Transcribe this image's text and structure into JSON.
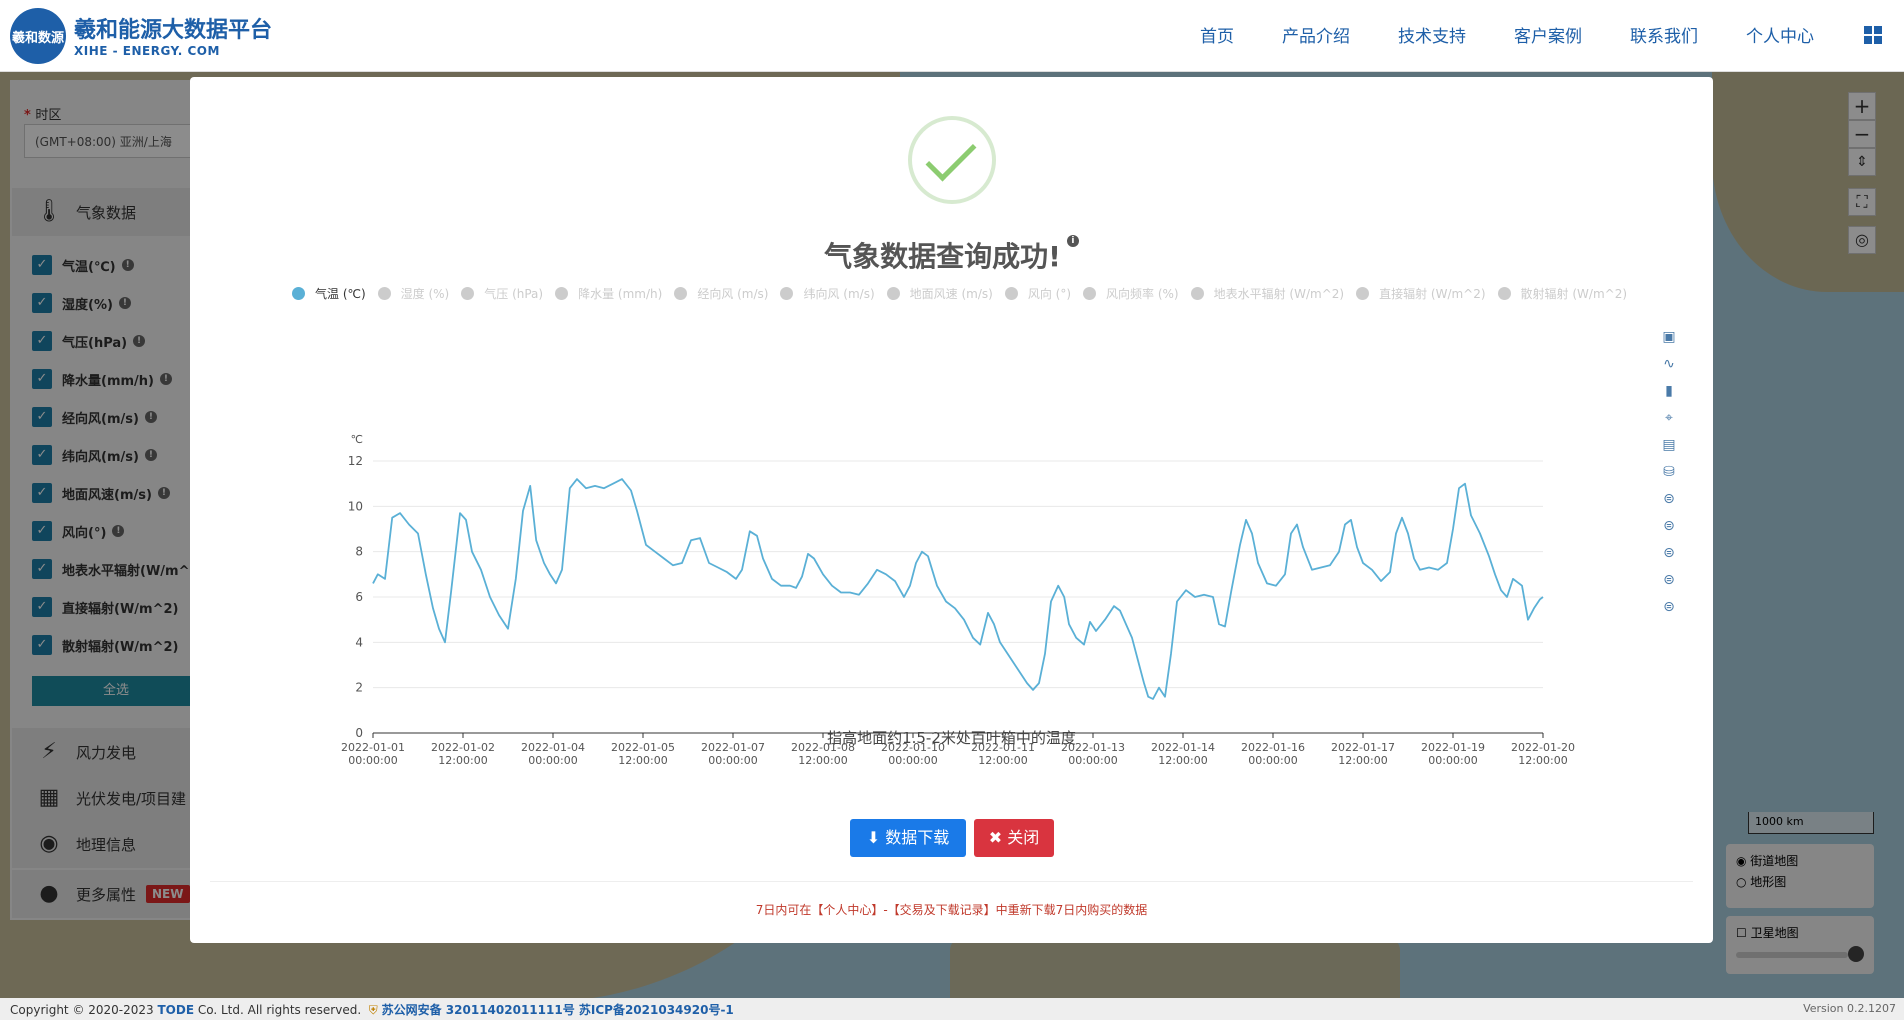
{
  "header": {
    "logo_text": "羲和数源",
    "title": "羲和能源大数据平台",
    "subtitle": "XIHE - ENERGY. COM",
    "nav": [
      "首页",
      "产品介绍",
      "技术支持",
      "客户案例",
      "联系我们",
      "个人中心"
    ]
  },
  "sidebar": {
    "timezone_label": "时区",
    "timezone_value": "(GMT+08:00) 亚洲/上海",
    "meteo_label": "气象数据",
    "items": [
      {
        "label": "气温(℃)"
      },
      {
        "label": "湿度(%)"
      },
      {
        "label": "气压(hPa)"
      },
      {
        "label": "降水量(mm/h)"
      },
      {
        "label": "经向风(m/s)"
      },
      {
        "label": "纬向风(m/s)"
      },
      {
        "label": "地面风速(m/s)"
      },
      {
        "label": "风向(°)"
      },
      {
        "label": "地表水平辐射(W/m^"
      },
      {
        "label": "直接辐射(W/m^2)"
      },
      {
        "label": "散射辐射(W/m^2)"
      }
    ],
    "select_all": "全选",
    "wind": "风力发电",
    "pv": "光伏发电/项目建",
    "geo": "地理信息",
    "more": "更多属性",
    "new_badge": "NEW"
  },
  "map": {
    "scale": "1000 km",
    "layer_street": "街道地图",
    "layer_terrain": "地形图",
    "satellite": "卫星地图",
    "satellite_opacity": 0.95
  },
  "footer": {
    "copyright": "Copyright © 2020-2023 ",
    "company": "TODE",
    "rights": " Co. Ltd. All rights reserved.",
    "beian": "苏公网安备 32011402011111号 苏ICP备2021034920号-1",
    "version": "Version 0.2.1207"
  },
  "modal": {
    "title": "气象数据查询成功!",
    "legend": [
      {
        "label": "气温 (℃)",
        "active": true
      },
      {
        "label": "湿度 (%)",
        "active": false
      },
      {
        "label": "气压 (hPa)",
        "active": false
      },
      {
        "label": "降水量 (mm/h)",
        "active": false
      },
      {
        "label": "经向风 (m/s)",
        "active": false
      },
      {
        "label": "纬向风 (m/s)",
        "active": false
      },
      {
        "label": "地面风速 (m/s)",
        "active": false
      },
      {
        "label": "风向 (°)",
        "active": false
      },
      {
        "label": "风向频率 (%)",
        "active": false
      },
      {
        "label": "地表水平辐射 (W/m^2)",
        "active": false
      },
      {
        "label": "直接辐射 (W/m^2)",
        "active": false
      },
      {
        "label": "散射辐射 (W/m^2)",
        "active": false
      }
    ],
    "description": "指高地面约1.5-2米处百叶箱中的温度",
    "download_label": "数据下载",
    "close_label": "关闭",
    "note": "7日内可在【个人中心】-【交易及下载记录】中重新下载7日内购买的数据"
  },
  "chart_data": {
    "type": "line",
    "series": [
      {
        "name": "气温 (℃)",
        "color": "#5ab0d6"
      }
    ],
    "ylabel": "℃",
    "ylim": [
      0,
      12
    ],
    "yticks": [
      0,
      2,
      4,
      6,
      8,
      10,
      12
    ],
    "xlim": [
      0,
      19.5
    ],
    "xticks": [
      {
        "x": 0,
        "date": "2022-01-01",
        "time": "00:00:00"
      },
      {
        "x": 1.5,
        "date": "2022-01-02",
        "time": "12:00:00"
      },
      {
        "x": 3,
        "date": "2022-01-04",
        "time": "00:00:00"
      },
      {
        "x": 4.5,
        "date": "2022-01-05",
        "time": "12:00:00"
      },
      {
        "x": 6,
        "date": "2022-01-07",
        "time": "00:00:00"
      },
      {
        "x": 7.5,
        "date": "2022-01-08",
        "time": "12:00:00"
      },
      {
        "x": 9,
        "date": "2022-01-10",
        "time": "00:00:00"
      },
      {
        "x": 10.5,
        "date": "2022-01-11",
        "time": "12:00:00"
      },
      {
        "x": 12,
        "date": "2022-01-13",
        "time": "00:00:00"
      },
      {
        "x": 13.5,
        "date": "2022-01-14",
        "time": "12:00:00"
      },
      {
        "x": 15,
        "date": "2022-01-16",
        "time": "00:00:00"
      },
      {
        "x": 16.5,
        "date": "2022-01-17",
        "time": "12:00:00"
      },
      {
        "x": 18,
        "date": "2022-01-19",
        "time": "00:00:00"
      },
      {
        "x": 19.5,
        "date": "2022-01-20",
        "time": "12:00:00"
      }
    ],
    "points": [
      [
        0,
        6.6
      ],
      [
        0.08,
        7.0
      ],
      [
        0.2,
        6.8
      ],
      [
        0.32,
        9.5
      ],
      [
        0.45,
        9.7
      ],
      [
        0.6,
        9.2
      ],
      [
        0.75,
        8.8
      ],
      [
        0.88,
        7.0
      ],
      [
        1.0,
        5.5
      ],
      [
        1.1,
        4.6
      ],
      [
        1.2,
        4.0
      ],
      [
        1.3,
        6.2
      ],
      [
        1.45,
        9.7
      ],
      [
        1.55,
        9.4
      ],
      [
        1.65,
        8.0
      ],
      [
        1.8,
        7.2
      ],
      [
        1.95,
        6.0
      ],
      [
        2.1,
        5.2
      ],
      [
        2.25,
        4.6
      ],
      [
        2.38,
        6.8
      ],
      [
        2.5,
        9.8
      ],
      [
        2.62,
        10.9
      ],
      [
        2.72,
        8.5
      ],
      [
        2.85,
        7.5
      ],
      [
        2.95,
        7.0
      ],
      [
        3.05,
        6.6
      ],
      [
        3.15,
        7.2
      ],
      [
        3.28,
        10.8
      ],
      [
        3.4,
        11.2
      ],
      [
        3.55,
        10.8
      ],
      [
        3.7,
        10.9
      ],
      [
        3.85,
        10.8
      ],
      [
        4.0,
        11.0
      ],
      [
        4.15,
        11.2
      ],
      [
        4.3,
        10.7
      ],
      [
        4.4,
        9.8
      ],
      [
        4.55,
        8.3
      ],
      [
        4.7,
        8.0
      ],
      [
        4.85,
        7.7
      ],
      [
        5.0,
        7.4
      ],
      [
        5.15,
        7.5
      ],
      [
        5.3,
        8.5
      ],
      [
        5.45,
        8.6
      ],
      [
        5.6,
        7.5
      ],
      [
        5.75,
        7.3
      ],
      [
        5.9,
        7.1
      ],
      [
        6.05,
        6.8
      ],
      [
        6.15,
        7.2
      ],
      [
        6.28,
        8.9
      ],
      [
        6.4,
        8.7
      ],
      [
        6.5,
        7.7
      ],
      [
        6.65,
        6.8
      ],
      [
        6.8,
        6.5
      ],
      [
        6.95,
        6.5
      ],
      [
        7.05,
        6.4
      ],
      [
        7.15,
        6.9
      ],
      [
        7.25,
        7.9
      ],
      [
        7.35,
        7.7
      ],
      [
        7.5,
        7.0
      ],
      [
        7.65,
        6.5
      ],
      [
        7.8,
        6.2
      ],
      [
        7.95,
        6.2
      ],
      [
        8.1,
        6.1
      ],
      [
        8.25,
        6.6
      ],
      [
        8.4,
        7.2
      ],
      [
        8.55,
        7.0
      ],
      [
        8.7,
        6.7
      ],
      [
        8.85,
        6.0
      ],
      [
        8.95,
        6.5
      ],
      [
        9.05,
        7.5
      ],
      [
        9.15,
        8.0
      ],
      [
        9.25,
        7.8
      ],
      [
        9.4,
        6.5
      ],
      [
        9.55,
        5.8
      ],
      [
        9.7,
        5.5
      ],
      [
        9.85,
        5.0
      ],
      [
        10.0,
        4.2
      ],
      [
        10.12,
        3.9
      ],
      [
        10.25,
        5.3
      ],
      [
        10.35,
        4.8
      ],
      [
        10.45,
        4.0
      ],
      [
        10.6,
        3.4
      ],
      [
        10.75,
        2.8
      ],
      [
        10.9,
        2.2
      ],
      [
        11.0,
        1.9
      ],
      [
        11.1,
        2.2
      ],
      [
        11.2,
        3.5
      ],
      [
        11.3,
        5.8
      ],
      [
        11.42,
        6.5
      ],
      [
        11.52,
        6.0
      ],
      [
        11.6,
        4.8
      ],
      [
        11.72,
        4.2
      ],
      [
        11.85,
        3.9
      ],
      [
        11.95,
        4.9
      ],
      [
        12.05,
        4.5
      ],
      [
        12.2,
        5.0
      ],
      [
        12.35,
        5.6
      ],
      [
        12.45,
        5.4
      ],
      [
        12.55,
        4.8
      ],
      [
        12.65,
        4.2
      ],
      [
        12.75,
        3.2
      ],
      [
        12.85,
        2.2
      ],
      [
        12.92,
        1.6
      ],
      [
        13.0,
        1.5
      ],
      [
        13.1,
        2.0
      ],
      [
        13.2,
        1.6
      ],
      [
        13.3,
        3.5
      ],
      [
        13.4,
        5.8
      ],
      [
        13.55,
        6.3
      ],
      [
        13.7,
        6.0
      ],
      [
        13.85,
        6.1
      ],
      [
        14.0,
        6.0
      ],
      [
        14.1,
        4.8
      ],
      [
        14.2,
        4.7
      ],
      [
        14.3,
        6.2
      ],
      [
        14.45,
        8.3
      ],
      [
        14.55,
        9.4
      ],
      [
        14.65,
        8.8
      ],
      [
        14.75,
        7.5
      ],
      [
        14.9,
        6.6
      ],
      [
        15.05,
        6.5
      ],
      [
        15.2,
        7.0
      ],
      [
        15.3,
        8.8
      ],
      [
        15.4,
        9.2
      ],
      [
        15.5,
        8.2
      ],
      [
        15.65,
        7.2
      ],
      [
        15.8,
        7.3
      ],
      [
        15.95,
        7.4
      ],
      [
        16.1,
        8.0
      ],
      [
        16.2,
        9.2
      ],
      [
        16.3,
        9.4
      ],
      [
        16.4,
        8.2
      ],
      [
        16.5,
        7.5
      ],
      [
        16.65,
        7.2
      ],
      [
        16.8,
        6.7
      ],
      [
        16.95,
        7.1
      ],
      [
        17.05,
        8.8
      ],
      [
        17.15,
        9.5
      ],
      [
        17.25,
        8.8
      ],
      [
        17.35,
        7.7
      ],
      [
        17.45,
        7.2
      ],
      [
        17.6,
        7.3
      ],
      [
        17.75,
        7.2
      ],
      [
        17.9,
        7.5
      ],
      [
        18.0,
        9.0
      ],
      [
        18.1,
        10.8
      ],
      [
        18.2,
        11.0
      ],
      [
        18.3,
        9.6
      ],
      [
        18.45,
        8.8
      ],
      [
        18.6,
        7.8
      ],
      [
        18.7,
        7.0
      ],
      [
        18.8,
        6.3
      ],
      [
        18.9,
        6.0
      ],
      [
        19.0,
        6.8
      ],
      [
        19.15,
        6.5
      ],
      [
        19.25,
        5.0
      ],
      [
        19.35,
        5.5
      ],
      [
        19.45,
        5.9
      ],
      [
        19.5,
        6.0
      ]
    ],
    "grid": true
  }
}
